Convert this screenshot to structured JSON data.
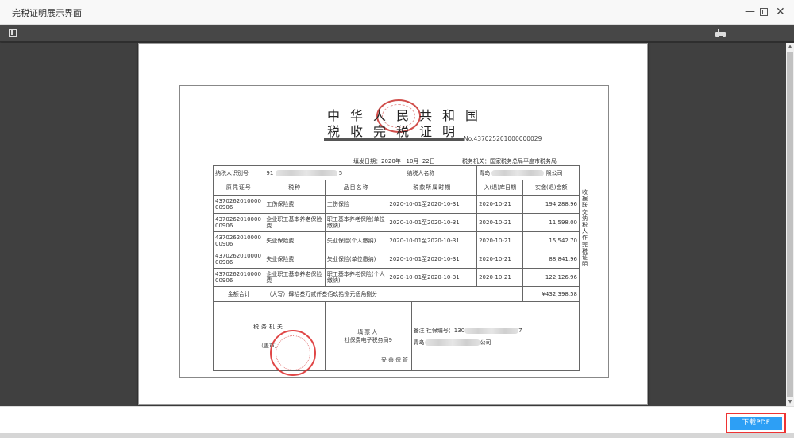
{
  "window": {
    "title": "完税证明展示界面",
    "controls": {
      "minimize": "—",
      "maximize": "",
      "close": "✕"
    }
  },
  "viewer": {
    "toolbar": {
      "sidebar_toggle": "sidebar-toggle-icon",
      "print": "print-icon"
    },
    "scrollbar": {
      "up": "▲",
      "down": "▼"
    }
  },
  "certificate": {
    "heading_line1": "中华人民共和国",
    "heading_line2": "税收完税证明",
    "number": "No.437025201000000029",
    "fill_date": "填发日期：2020年   10月  22日",
    "tax_office": "税务机关：国家税务总局平度市税务局",
    "taxpayer_id_label": "纳税人识别号",
    "taxpayer_id_prefix": "91",
    "taxpayer_id_suffix": "5",
    "taxpayer_name_label": "纳税人名称",
    "taxpayer_name_prefix": "青岛",
    "taxpayer_name_suffix": "限公司",
    "columns": [
      "原凭证号",
      "税种",
      "品目名称",
      "税款所属时期",
      "入(退)库日期",
      "实缴(退)金额"
    ],
    "rows": [
      {
        "voucher": "437026201000000906",
        "tax_type": "工伤保险费",
        "item": "工伤保险",
        "period": "2020-10-01至2020-10-31",
        "date": "2020-10-21",
        "amount": "194,288.96"
      },
      {
        "voucher": "437026201000000906",
        "tax_type": "企业职工基本养老保险费",
        "item": "职工基本养老保险(单位缴纳)",
        "period": "2020-10-01至2020-10-31",
        "date": "2020-10-21",
        "amount": "11,598.00"
      },
      {
        "voucher": "437026201000000906",
        "tax_type": "失业保险费",
        "item": "失业保险(个人缴纳)",
        "period": "2020-10-01至2020-10-31",
        "date": "2020-10-21",
        "amount": "15,542.70"
      },
      {
        "voucher": "437026201000000906",
        "tax_type": "失业保险费",
        "item": "失业保险(单位缴纳)",
        "period": "2020-10-01至2020-10-31",
        "date": "2020-10-21",
        "amount": "88,841.96"
      },
      {
        "voucher": "437026201000000906",
        "tax_type": "企业职工基本养老保险费",
        "item": "职工基本养老保险(个人缴纳)",
        "period": "2020-10-01至2020-10-31",
        "date": "2020-10-21",
        "amount": "122,126.96"
      }
    ],
    "total_label": "金额合计",
    "total_words": "（大写）肆拾叁万贰仟叁佰玖拾捌元伍角捌分",
    "total_amount": "¥432,398.58",
    "tax_office_seal_label": "税务机关",
    "seal_note": "（盖章）",
    "filler_label": "填票人",
    "filler_value": "社保费电子税务局9",
    "remark_line1_prefix": "备注 社保编号：130",
    "remark_line1_suffix": "7",
    "remark_line2_prefix": "青岛",
    "remark_line2_suffix": "公司",
    "side_note": "收据联交纳税人作完税证明",
    "keep_note": "妥善保管"
  },
  "footer": {
    "download_label": "下载PDF",
    "accent_color": "#2d9ff5",
    "highlight_color": "#ee3333"
  }
}
